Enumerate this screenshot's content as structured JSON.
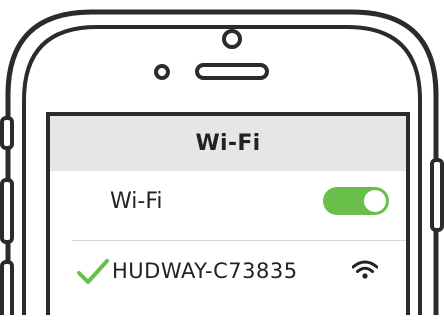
{
  "nav": {
    "title": "Wi-Fi"
  },
  "wifi_row": {
    "label": "Wi-Fi",
    "toggle_on": true,
    "toggle_color": "#6abf4b"
  },
  "network": {
    "name": "HUDWAY-C73835",
    "connected": true,
    "check_color": "#6abf4b"
  },
  "icons": {
    "check": "checkmark-icon",
    "signal": "wifi-signal-icon"
  }
}
